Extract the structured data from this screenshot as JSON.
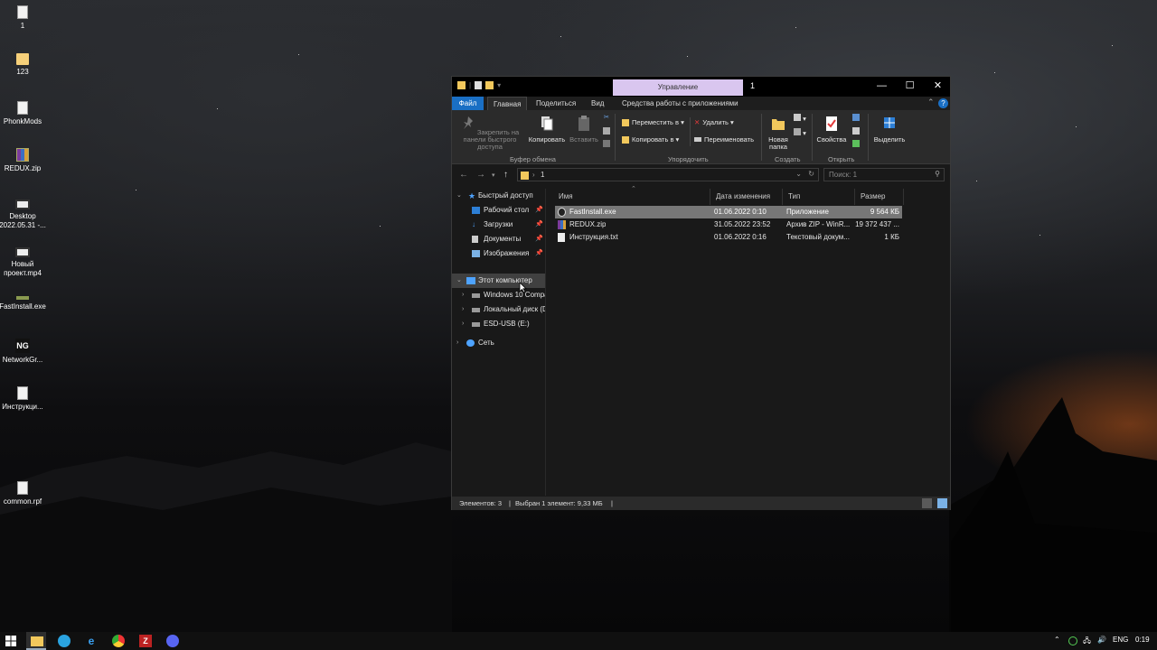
{
  "desktop": {
    "icons": [
      {
        "label": "1",
        "icon": "archive-icon"
      },
      {
        "label": "123",
        "icon": "folder-icon"
      },
      {
        "label": "PhonkMods",
        "icon": "archive-icon"
      },
      {
        "label": "REDUX.zip",
        "icon": "winrar-icon"
      },
      {
        "label": "Desktop 2022.05.31 -...",
        "icon": "video-icon"
      },
      {
        "label": "Новый проект.mp4",
        "icon": "video-icon"
      },
      {
        "label": "FastInstall.exe",
        "icon": "exe-icon"
      },
      {
        "label": "NetworkGr...",
        "icon": "networkgraph-icon"
      },
      {
        "label": "Инструкци...",
        "icon": "text-file-icon"
      },
      {
        "label": "common.rpf",
        "icon": "file-icon"
      }
    ]
  },
  "window": {
    "title": "1",
    "manage_tab": "Управление",
    "controls": {
      "minimize": "—",
      "maximize": "☐",
      "close": "✕"
    },
    "tabs": {
      "file": "Файл",
      "home": "Главная",
      "share": "Поделиться",
      "view": "Вид",
      "app_tools": "Средства работы с приложениями"
    },
    "ribbon": {
      "pin_quick_access": "Закрепить на панели быстрого доступа",
      "copy": "Копировать",
      "paste": "Вставить",
      "move_to": "Переместить в ▾",
      "copy_to": "Копировать в ▾",
      "delete": "Удалить ▾",
      "rename": "Переименовать",
      "new_folder": "Новая папка",
      "properties": "Свойства",
      "select": "Выделить",
      "group_clipboard": "Буфер обмена",
      "group_organize": "Упорядочить",
      "group_create": "Создать",
      "group_open": "Открыть"
    },
    "address": {
      "path": "1",
      "search_placeholder": "Поиск: 1"
    },
    "nav": {
      "quick_access": "Быстрый доступ",
      "desktop": "Рабочий стол",
      "downloads": "Загрузки",
      "documents": "Документы",
      "pictures": "Изображения",
      "this_pc": "Этот компьютер",
      "windows_drive": "Windows 10 Compa",
      "local_disk": "Локальный диск (D",
      "esd_usb": "ESD-USB (E:)",
      "network": "Сеть"
    },
    "columns": {
      "name": "Имя",
      "date": "Дата изменения",
      "type": "Тип",
      "size": "Размер"
    },
    "files": [
      {
        "name": "FastInstall.exe",
        "date": "01.06.2022 0:10",
        "type": "Приложение",
        "size": "9 564 КБ",
        "selected": true
      },
      {
        "name": "REDUX.zip",
        "date": "31.05.2022 23:52",
        "type": "Архив ZIP - WinR...",
        "size": "19 372 437 ..."
      },
      {
        "name": "Инструкция.txt",
        "date": "01.06.2022 0:16",
        "type": "Текстовый докум...",
        "size": "1 КБ"
      }
    ],
    "status": {
      "count": "Элементов: 3",
      "selected": "Выбран 1 элемент: 9,33 МБ"
    }
  },
  "taskbar": {
    "language": "ENG",
    "time": "0:19"
  },
  "colors": {
    "accent": "#1a6fc4",
    "manage_tab": "#d9c6ef",
    "selection": "#777777"
  }
}
